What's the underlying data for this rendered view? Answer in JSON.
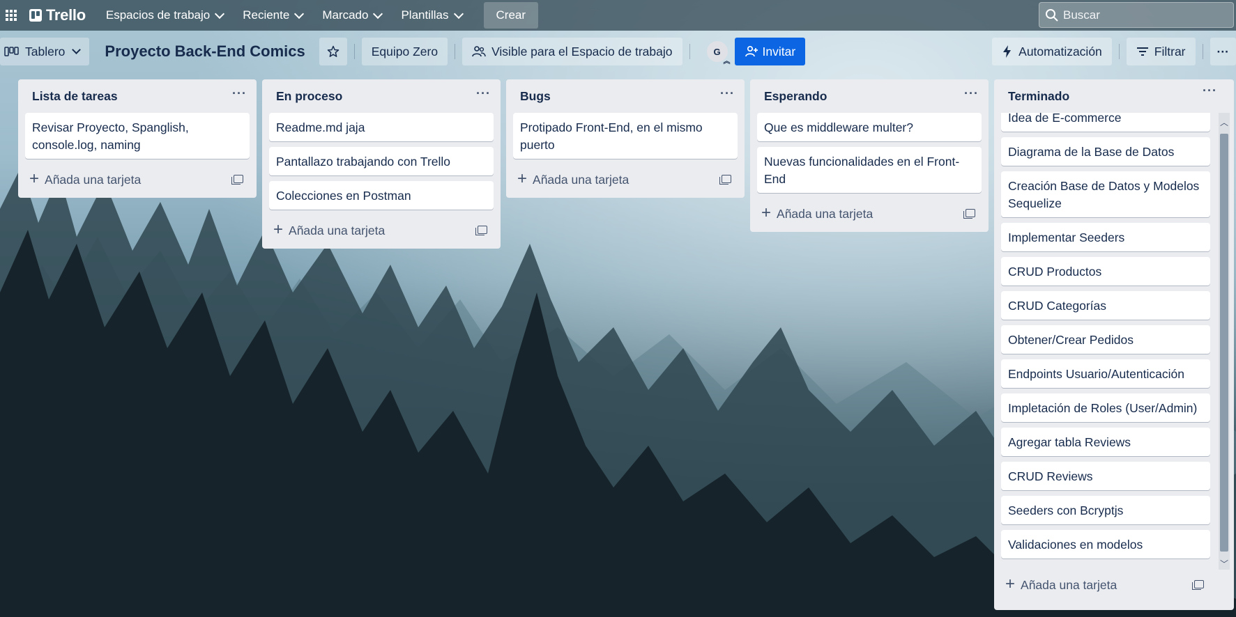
{
  "topbar": {
    "logo": "Trello",
    "nav": [
      {
        "label": "Espacios de trabajo"
      },
      {
        "label": "Reciente"
      },
      {
        "label": "Marcado"
      },
      {
        "label": "Plantillas"
      }
    ],
    "create_label": "Crear",
    "search_placeholder": "Buscar"
  },
  "board": {
    "view_label": "Tablero",
    "title": "Proyecto Back-End Comics",
    "workspace_label": "Equipo Zero",
    "visibility_label": "Visible para el Espacio de trabajo",
    "avatar_initial": "G",
    "invite_label": "Invitar",
    "automation_label": "Automatización",
    "filter_label": "Filtrar"
  },
  "add_card_label": "Añada una tarjeta",
  "lists": [
    {
      "title": "Lista de tareas",
      "cards": [
        "Revisar Proyecto, Spanglish, console.log, naming"
      ]
    },
    {
      "title": "En proceso",
      "cards": [
        "Readme.md jaja",
        "Pantallazo trabajando con Trello",
        "Colecciones en Postman"
      ]
    },
    {
      "title": "Bugs",
      "cards": [
        "Protipado Front-End, en el mismo puerto"
      ]
    },
    {
      "title": "Esperando",
      "cards": [
        "Que es middleware multer?",
        "Nuevas funcionalidades en el Front-End"
      ]
    },
    {
      "title": "Terminado",
      "cards": [
        "Idea de E-commerce",
        "Diagrama de la Base de Datos",
        "Creación Base de Datos y Modelos Sequelize",
        "Implementar Seeders",
        "CRUD Productos",
        "CRUD Categorías",
        "Obtener/Crear Pedidos",
        "Endpoints Usuario/Autenticación",
        "Impletación de Roles (User/Admin)",
        "Agregar tabla Reviews",
        "CRUD Reviews",
        "Seeders con Bcryptjs",
        "Validaciones en modelos"
      ]
    }
  ]
}
